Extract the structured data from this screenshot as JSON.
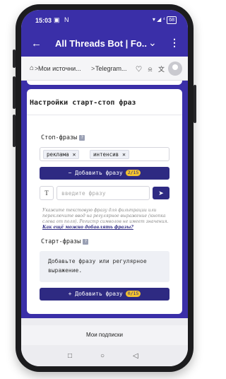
{
  "status": {
    "time": "15:03",
    "left_icons": "▣ N",
    "right_icons": "▾ ◢ ⁴",
    "battery": "68"
  },
  "titlebar": {
    "title": "All Threads Bot | Fo...",
    "back_icon": "back-arrow-icon",
    "dropdown_icon": "chevron-down-icon",
    "more_icon": "more-vert-icon"
  },
  "urlbar": {
    "crumb1": "Мои источни...",
    "crumb2": "Telegram...",
    "separator": ">",
    "icons": "♡ ⍾ 文"
  },
  "card": {
    "title": "Настройки старт-стоп фраз",
    "stop_phrases": {
      "label": "Стоп-фразы",
      "tags": [
        "реклама",
        "интенсив"
      ],
      "add_button": "Добавить фразу",
      "add_button_icon": "−",
      "add_count": "2/15",
      "input_placeholder": "введите фразу",
      "type_toggle": "T",
      "send_icon": "➤",
      "hint": "Укажите текстовую фразу для фильтрации или переключите ввод на регулярное выражение (кнопка слева от поля). Регистр символов не имеет значения.",
      "hint_link": "Как ещё можно добавлять фразы?"
    },
    "start_phrases": {
      "label": "Старт-фразы",
      "placeholder_text": "Добавьте фразу или регулярное выражение.",
      "add_button": "Добавить фразу",
      "add_button_icon": "+",
      "add_count": "0/15"
    }
  },
  "bottom": {
    "subscriptions_label": "Мои подписки",
    "nav_square": "□",
    "nav_circle": "○",
    "nav_back": "◁"
  }
}
